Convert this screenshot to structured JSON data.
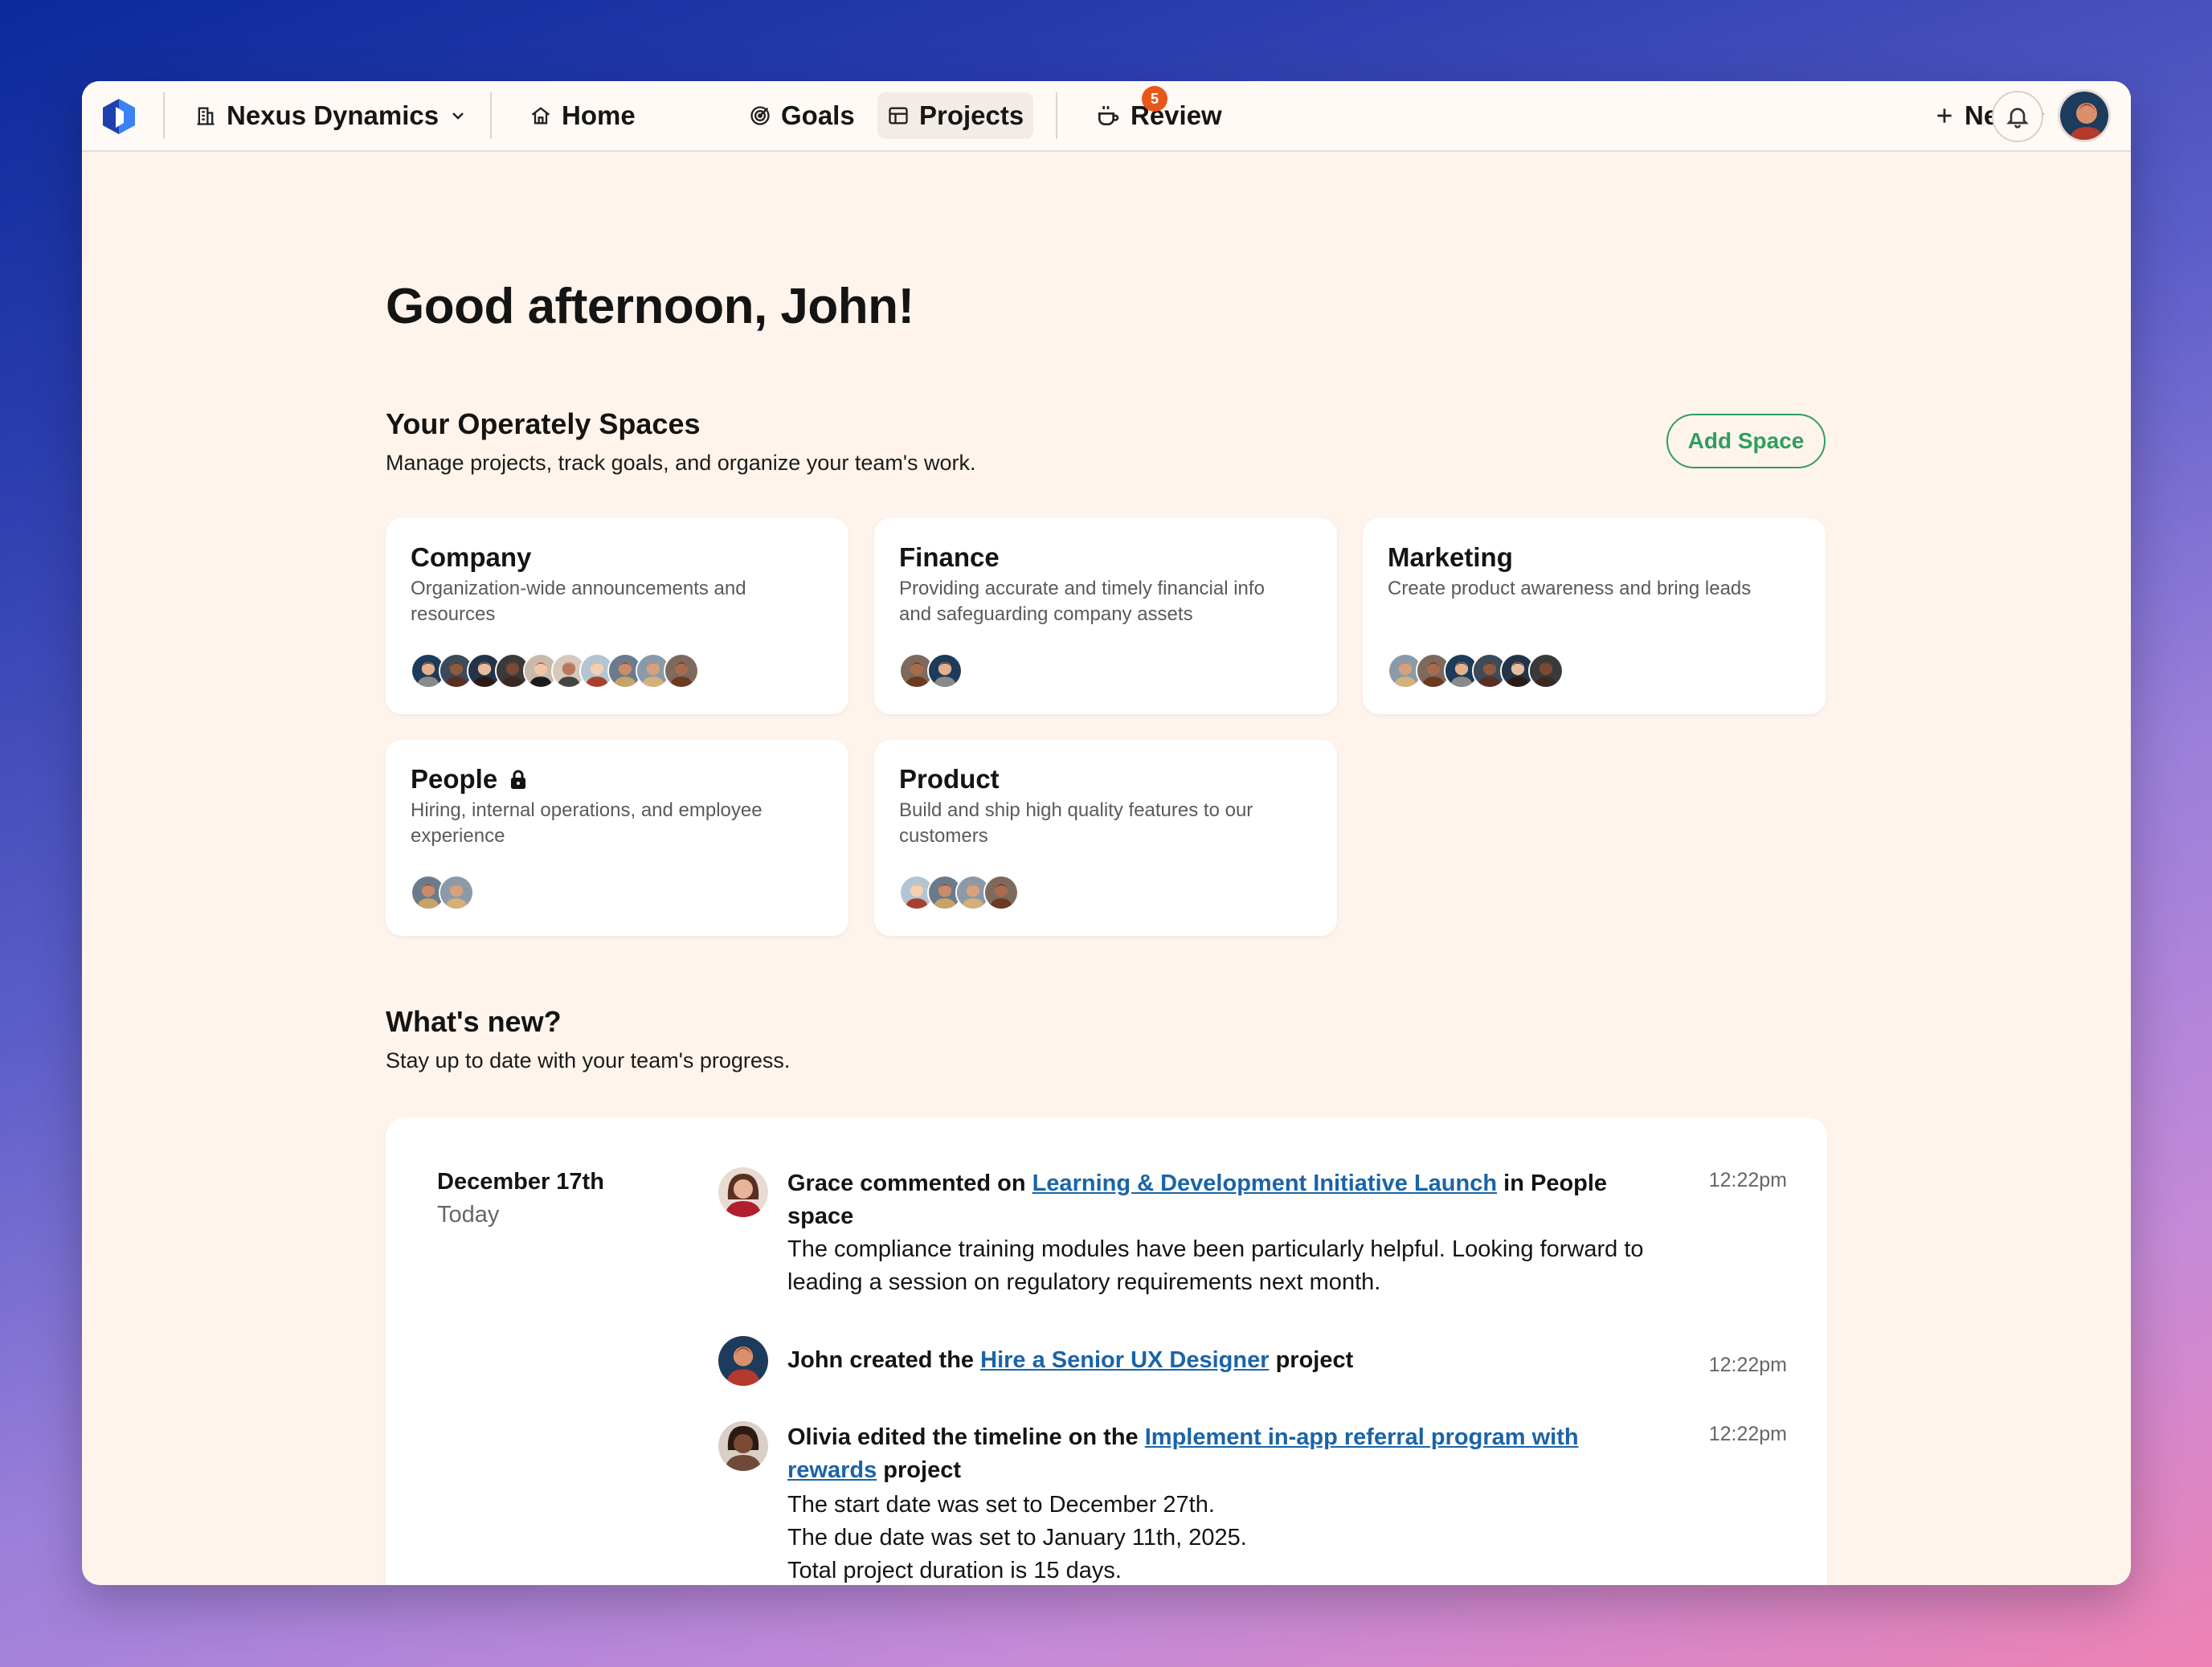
{
  "topbar": {
    "org_name": "Nexus Dynamics",
    "nav": [
      {
        "label": "Home",
        "icon": "home-icon"
      },
      {
        "label": "Goals",
        "icon": "target-icon"
      },
      {
        "label": "Projects",
        "icon": "table-icon"
      },
      {
        "label": "Review",
        "icon": "coffee-icon",
        "badge": "5"
      }
    ],
    "new_label": "New",
    "accent_badge_color": "#e8571a"
  },
  "greeting": "Good afternoon, John!",
  "spaces": {
    "title": "Your Operately Spaces",
    "subtitle": "Manage projects, track goals, and organize your team's work.",
    "add_label": "Add Space",
    "accent_color": "#2f9e5f",
    "cards": [
      {
        "name": "Company",
        "description": "Organization-wide announcements and resources",
        "member_count": 10,
        "locked": false
      },
      {
        "name": "Finance",
        "description": "Providing accurate and timely financial info and safeguarding company assets",
        "member_count": 2,
        "locked": false
      },
      {
        "name": "Marketing",
        "description": "Create product awareness and bring leads",
        "member_count": 6,
        "locked": false
      },
      {
        "name": "People",
        "description": "Hiring, internal operations, and employee experience",
        "member_count": 2,
        "locked": true
      },
      {
        "name": "Product",
        "description": "Build and ship high quality features to our customers",
        "member_count": 4,
        "locked": false
      }
    ]
  },
  "whats_new": {
    "title": "What's new?",
    "subtitle": "Stay up to date with your team's progress.",
    "date": "December 17th",
    "day": "Today",
    "items": [
      {
        "prefix": "Grace commented on ",
        "link": "Learning & Development Initiative Launch",
        "suffix": " in People space",
        "message": "The compliance training modules have been particularly helpful. Looking forward to leading a session on regulatory requirements next month.",
        "time": "12:22pm"
      },
      {
        "prefix": "John created the ",
        "link": "Hire a Senior UX Designer",
        "suffix": " project",
        "time": "12:22pm"
      },
      {
        "prefix": "Olivia edited the timeline on the ",
        "link": "Implement in-app referral program with rewards",
        "suffix": " project",
        "lines": [
          "The start date was set to December 27th.",
          "The due date was set to January 11th, 2025.",
          "Total project duration is 15 days."
        ],
        "time": "12:22pm"
      }
    ]
  }
}
